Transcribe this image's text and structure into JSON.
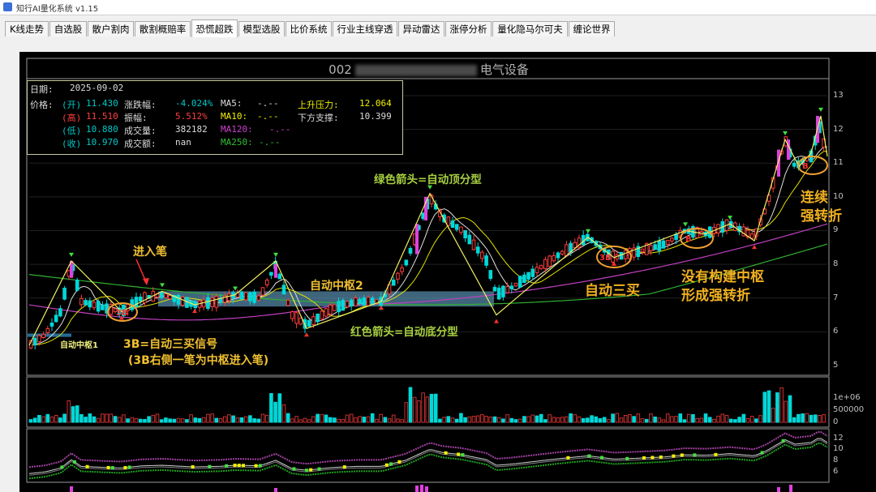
{
  "app": {
    "title": "知行AI量化系统 v1.15"
  },
  "tabs": [
    {
      "label": "K线走势",
      "active": false
    },
    {
      "label": "自选股",
      "active": false
    },
    {
      "label": "散户割肉",
      "active": false
    },
    {
      "label": "散割概赔率",
      "active": false
    },
    {
      "label": "恐慌超跌",
      "active": true
    },
    {
      "label": "模型选股",
      "active": false
    },
    {
      "label": "比价系统",
      "active": false
    },
    {
      "label": "行业主线穿透",
      "active": false
    },
    {
      "label": "异动雷达",
      "active": false
    },
    {
      "label": "涨停分析",
      "active": false
    },
    {
      "label": "量化隐马尔可夫",
      "active": false
    },
    {
      "label": "缠论世界",
      "active": false
    }
  ],
  "stock": {
    "code_prefix": "002",
    "industry": "电气设备"
  },
  "info": {
    "date_label": "日期:",
    "date": "2025-09-02",
    "price_label": "价格:",
    "open_label": "(开)",
    "open": "11.430",
    "high_label": "(高)",
    "high": "11.510",
    "low_label": "(低)",
    "low": "10.880",
    "close_label": "(收)",
    "close": "10.970",
    "change_label": "涨跌幅:",
    "change": "-4.024%",
    "amp_label": "振幅:",
    "amp": "5.512%",
    "vol_label": "成交量:",
    "vol": "382182",
    "amt_label": "成交额:",
    "amt": "nan",
    "ma5_label": "MA5:",
    "ma5": "-.--",
    "ma10_label": "MA10:",
    "ma10": "-.--",
    "ma120_label": "MA120:",
    "ma120": "-.--",
    "ma250_label": "MA250:",
    "ma250": "-.--",
    "resist_label": "上升压力:",
    "resist": "12.064",
    "support_label": "下方支撑:",
    "support": "10.399"
  },
  "annotations": {
    "entry": "进入笔",
    "zs2": "自动中枢2",
    "zs1": "自动中枢1",
    "top_fx": "绿色箭头=自动顶分型",
    "bottom_fx": "红色箭头=自动底分型",
    "b3_signal": "3B=自动三买信号",
    "b3_note": "(3B右侧一笔为中枢进入笔)",
    "auto3buy": "自动三买",
    "no_zs_1": "没有构建中枢",
    "no_zs_2": "形成强转折",
    "cont_1": "连续",
    "cont_2": "强转折",
    "badge_3b": "3B",
    "badge_b": "B"
  },
  "axes": {
    "price_ticks": [
      "13",
      "12",
      "11",
      "10",
      "9",
      "8",
      "7",
      "6",
      "5"
    ],
    "volume_ticks": [
      "1e+06",
      "500000",
      "0"
    ],
    "indicator_ticks": [
      "12",
      "10",
      "8",
      "6"
    ]
  },
  "colors": {
    "up": "#ff3c3c",
    "down": "#00e0e0",
    "annotation": "#f0c030",
    "green_ann": "#a8d040",
    "purple": "#c040c0"
  },
  "chart_data": {
    "type": "candlestick",
    "ylim": [
      5,
      13
    ],
    "zs1": [
      5.85,
      5.95
    ],
    "zs2": [
      6.75,
      7.2
    ],
    "support": 10.399,
    "resist": 12.064,
    "close_last": 10.97
  }
}
